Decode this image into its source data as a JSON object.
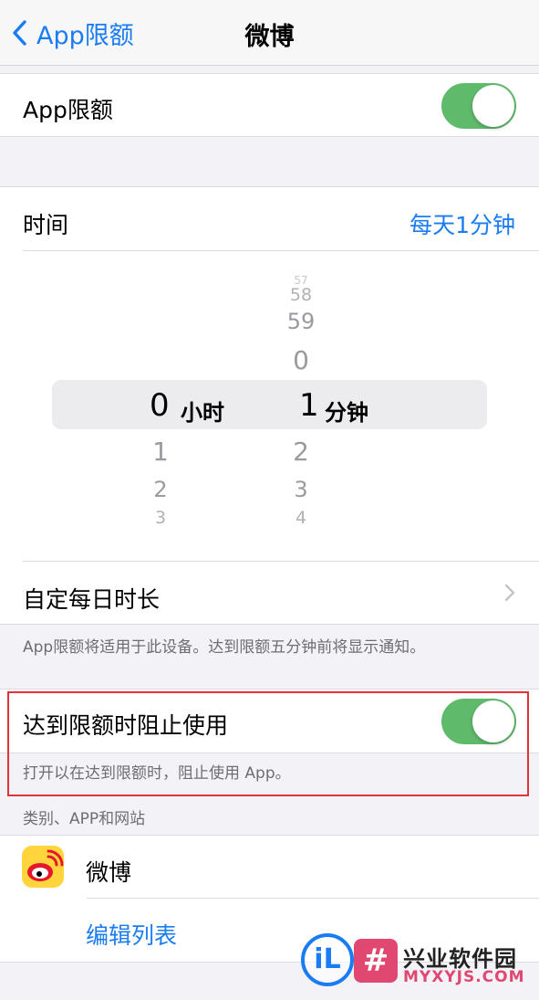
{
  "nav": {
    "back_label": "App限额",
    "title": "微博"
  },
  "limit_toggle": {
    "label": "App限额",
    "on": true
  },
  "time": {
    "label": "时间",
    "value": "每天1分钟",
    "picker": {
      "hours": {
        "above": [],
        "selected": "0",
        "below": [
          "1",
          "2",
          "3"
        ],
        "unit": "小时"
      },
      "minutes": {
        "above": [
          "57",
          "58",
          "59",
          "0"
        ],
        "selected": "1",
        "below": [
          "2",
          "3",
          "4"
        ],
        "unit": "分钟"
      }
    }
  },
  "custom_days": {
    "label": "自定每日时长"
  },
  "limit_note": "App限额将适用于此设备。达到限额五分钟前将显示通知。",
  "block_toggle": {
    "label": "达到限额时阻止使用",
    "on": true,
    "note": "打开以在达到限额时，阻止使用 App。"
  },
  "apps_section": {
    "header": "类别、APP和网站",
    "items": [
      {
        "name": "微博",
        "icon": "weibo-app-icon"
      }
    ],
    "edit_label": "编辑列表"
  },
  "watermark": {
    "glyph": "iL",
    "box_glyph": "#",
    "name": "兴业软件园",
    "url": "MYXYJS.COM"
  },
  "colors": {
    "accent": "#1a7cf2",
    "switch_on": "#5fba6c",
    "highlight": "#e0343a"
  }
}
